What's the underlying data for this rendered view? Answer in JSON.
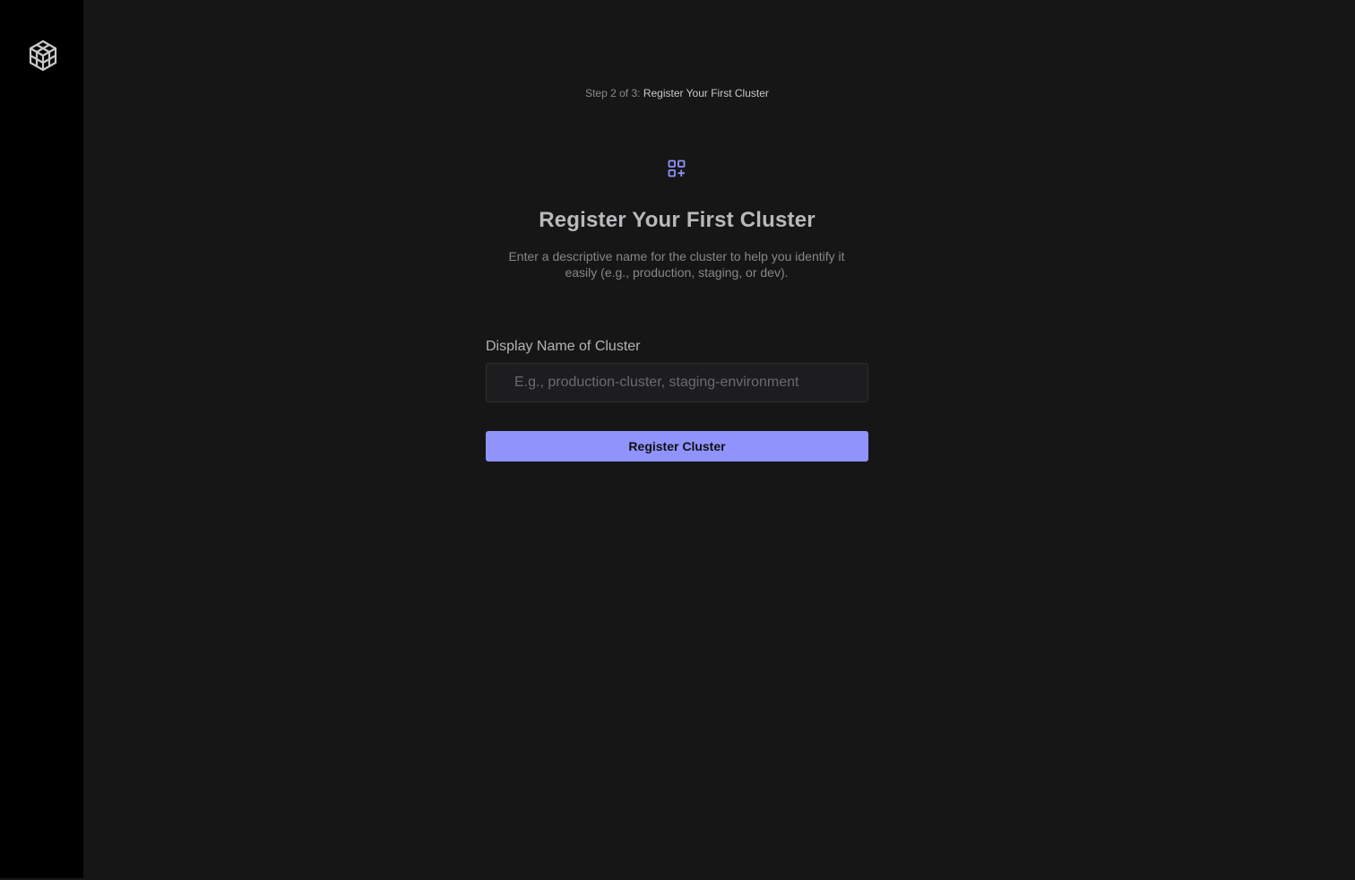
{
  "sidebar": {
    "logo_icon": "cube-knot-logo-icon"
  },
  "onboarding": {
    "step_prefix": "Step 2 of 3:",
    "step_title": "Register Your First Cluster",
    "hero_icon": "grid-plus-icon",
    "title": "Register Your First Cluster",
    "description": "Enter a descriptive name for the cluster to help you identify it easily (e.g., production, staging, or dev).",
    "form": {
      "cluster_name_label": "Display Name of Cluster",
      "cluster_name_value": "",
      "cluster_name_placeholder": "E.g., production-cluster, staging-environment",
      "submit_label": "Register Cluster"
    }
  },
  "colors": {
    "accent": "#8f93fb",
    "background": "#161617",
    "sidebar": "#000000"
  }
}
